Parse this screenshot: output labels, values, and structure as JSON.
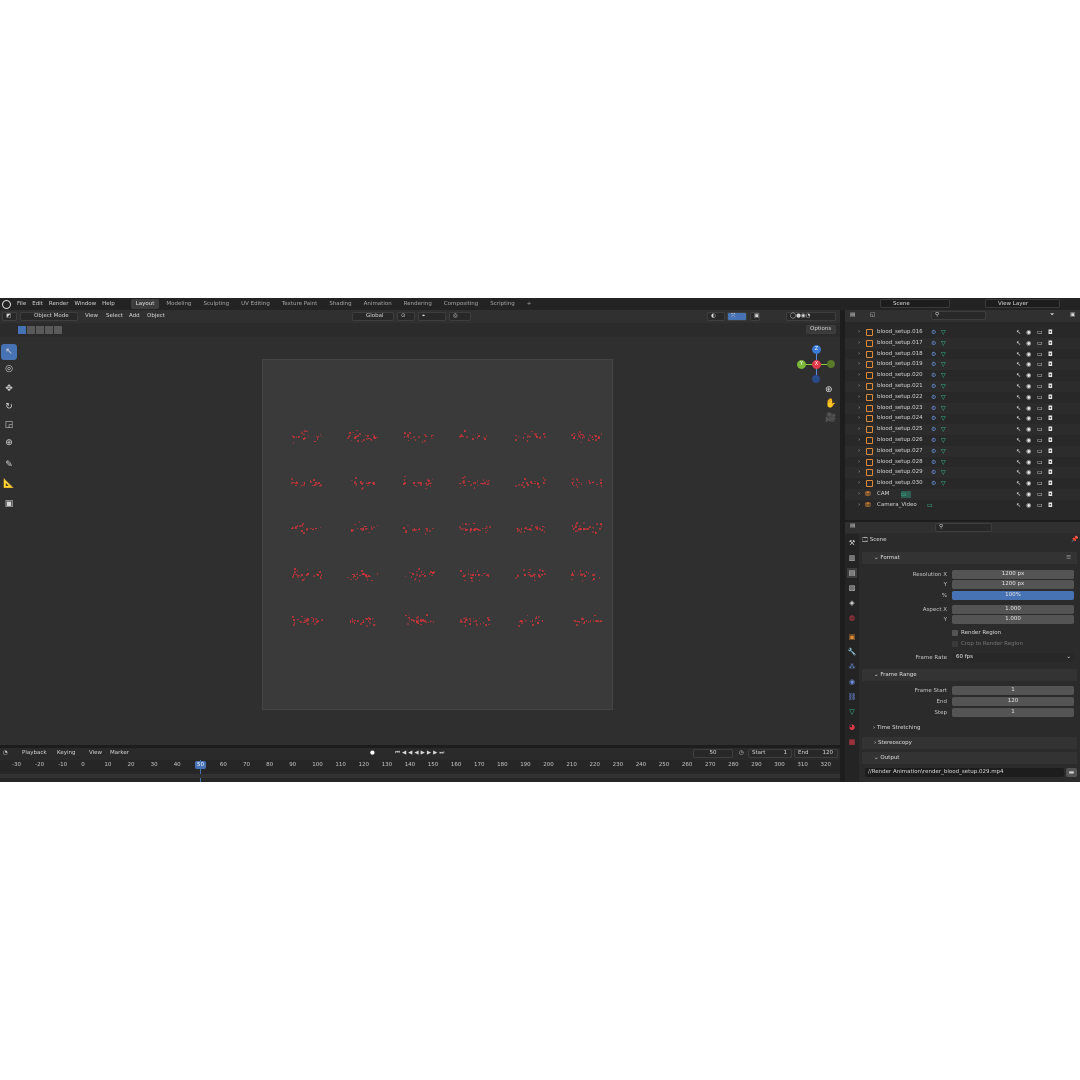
{
  "menu": [
    "File",
    "Edit",
    "Render",
    "Window",
    "Help"
  ],
  "workspaces": [
    "Layout",
    "Modeling",
    "Sculpting",
    "UV Editing",
    "Texture Paint",
    "Shading",
    "Animation",
    "Rendering",
    "Compositing",
    "Scripting"
  ],
  "active_workspace": "Layout",
  "scene_name": "Scene",
  "view_layer": "View Layer",
  "viewport_header": {
    "mode": "Object Mode",
    "menus": [
      "View",
      "Select",
      "Add",
      "Object"
    ],
    "orientation": "Global",
    "options": "Options"
  },
  "gizmo": {
    "z": "Z",
    "y": "Y",
    "x": "X"
  },
  "outliner": {
    "items": [
      "blood_setup.016",
      "blood_setup.017",
      "blood_setup.018",
      "blood_setup.019",
      "blood_setup.020",
      "blood_setup.021",
      "blood_setup.022",
      "blood_setup.023",
      "blood_setup.024",
      "blood_setup.025",
      "blood_setup.026",
      "blood_setup.027",
      "blood_setup.028",
      "blood_setup.029",
      "blood_setup.030"
    ],
    "cameras": [
      "CAM",
      "Camera_Video"
    ]
  },
  "properties": {
    "context": "Scene",
    "format_label": "Format",
    "resolution_x_label": "Resolution X",
    "resolution_x": "1200 px",
    "resolution_y_label": "Y",
    "resolution_y": "1200 px",
    "percent_label": "%",
    "percent": "100%",
    "aspect_x_label": "Aspect X",
    "aspect_x": "1.000",
    "aspect_y_label": "Y",
    "aspect_y": "1.000",
    "render_region": "Render Region",
    "crop_region": "Crop to Render Region",
    "frame_rate_label": "Frame Rate",
    "frame_rate": "60 fps",
    "frame_range_label": "Frame Range",
    "frame_start_label": "Frame Start",
    "frame_start": "1",
    "end_label": "End",
    "end": "120",
    "step_label": "Step",
    "step": "1",
    "time_stretching": "Time Stretching",
    "stereoscopy": "Stereoscopy",
    "output_label": "Output",
    "output_path": "//Render Animation\\render_blood_setup.029.mp4"
  },
  "timeline": {
    "menus": [
      "Playback",
      "Keying",
      "View",
      "Marker"
    ],
    "current_frame": "50",
    "start_label": "Start",
    "start": "1",
    "end_label": "End",
    "end": "120",
    "ticks": [
      "-30",
      "-20",
      "-10",
      "0",
      "10",
      "20",
      "30",
      "40",
      "50",
      "60",
      "70",
      "80",
      "90",
      "100",
      "110",
      "120",
      "130",
      "140",
      "150",
      "160",
      "170",
      "180",
      "190",
      "200",
      "210",
      "220",
      "230",
      "240",
      "250",
      "260",
      "270",
      "280",
      "290",
      "300",
      "310",
      "320"
    ]
  },
  "colors": {
    "accent": "#4772b3",
    "blood": "#d4333a",
    "object": "#e08a37",
    "mesh": "#39d0a3"
  }
}
